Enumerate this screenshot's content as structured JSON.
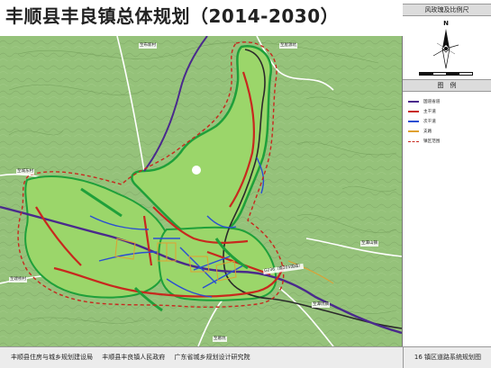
{
  "title": "丰顺县丰良镇总体规划（2014-2030）",
  "side_panel": {
    "compass_header": "风玫瑰及比例尺",
    "compass_letter": "N",
    "legend_header": "图　例",
    "legend_items": [
      {
        "label": "国道省道",
        "color": "#4a2a8c",
        "style": "solid",
        "icon": "road-line-icon"
      },
      {
        "label": "主干道",
        "color": "#c8281e",
        "style": "solid",
        "icon": "road-line-icon"
      },
      {
        "label": "次干道",
        "color": "#2a4fd2",
        "style": "solid",
        "icon": "road-line-icon"
      },
      {
        "label": "支路",
        "color": "#e0a030",
        "style": "solid",
        "icon": "road-line-icon"
      },
      {
        "label": "镇区范围",
        "color": "#c8281e",
        "style": "dashed",
        "icon": "boundary-line-icon"
      }
    ]
  },
  "map": {
    "place_labels": [
      {
        "text": "至布新村"
      },
      {
        "text": "至屋源坑"
      },
      {
        "text": "至城东村"
      },
      {
        "text": "至潭山镇"
      },
      {
        "text": "至建桥村"
      },
      {
        "text": "至潭坑镇"
      },
      {
        "text": "至葛坑"
      }
    ],
    "road_label": "G236（原205国道）"
  },
  "footer": {
    "orgs": [
      "丰顺县住房与城乡规划建设局",
      "丰顺县丰良镇人民政府",
      "广东省城乡规划设计研究院"
    ],
    "sheet_title": "16 镇区道路系统规划图"
  },
  "colors": {
    "terrain": "#8fbf72",
    "development": "#9bd66a",
    "river": "#2a2a2a",
    "primary_road": "#c8281e",
    "secondary_road": "#2a4fd2",
    "national_road": "#4a2a8c",
    "branch_road": "#e0a030",
    "greenway": "#1fa03a",
    "boundary": "#c8281e"
  }
}
